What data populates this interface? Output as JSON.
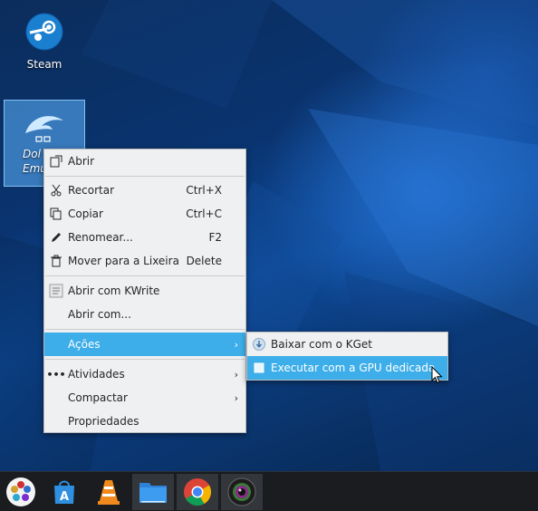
{
  "desktop": {
    "icons": [
      {
        "label": "Steam",
        "icon": "steam-icon"
      },
      {
        "label": "Dolphin Emulator",
        "label_line1": "Dol",
        "label_line2": "Emu",
        "icon": "dolphin-icon"
      }
    ]
  },
  "context_menu": {
    "items": [
      {
        "label": "Abrir",
        "shortcut": "",
        "icon": "open-icon"
      },
      {
        "label": "Recortar",
        "shortcut": "Ctrl+X",
        "icon": "scissors-icon"
      },
      {
        "label": "Copiar",
        "shortcut": "Ctrl+C",
        "icon": "copy-icon"
      },
      {
        "label": "Renomear...",
        "shortcut": "F2",
        "icon": "pencil-icon"
      },
      {
        "label": "Mover para a Lixeira",
        "shortcut": "Delete",
        "icon": "trash-icon"
      },
      {
        "label": "Abrir com KWrite",
        "shortcut": "",
        "icon": "kwrite-icon"
      },
      {
        "label": "Abrir com...",
        "shortcut": "",
        "icon": ""
      },
      {
        "label": "Ações",
        "shortcut": "",
        "icon": "",
        "submenu": true
      },
      {
        "label": "Atividades",
        "shortcut": "",
        "icon": "ellipsis-icon",
        "submenu": true
      },
      {
        "label": "Compactar",
        "shortcut": "",
        "icon": "",
        "submenu": true
      },
      {
        "label": "Propriedades",
        "shortcut": "",
        "icon": ""
      }
    ],
    "highlight_color": "#3daee9"
  },
  "submenu": {
    "items": [
      {
        "label": "Baixar com o KGet",
        "icon": "kget-icon"
      },
      {
        "label": "Executar com a GPU dedicada",
        "icon": "gpu-icon"
      }
    ]
  },
  "taskbar": {
    "apps": [
      {
        "name": "application-launcher",
        "icon": "launcher-icon"
      },
      {
        "name": "discover",
        "icon": "store-icon"
      },
      {
        "name": "vlc",
        "icon": "vlc-icon"
      },
      {
        "name": "file-manager",
        "icon": "folder-icon"
      },
      {
        "name": "chrome",
        "icon": "chrome-icon"
      },
      {
        "name": "webcam",
        "icon": "camera-icon"
      }
    ]
  }
}
